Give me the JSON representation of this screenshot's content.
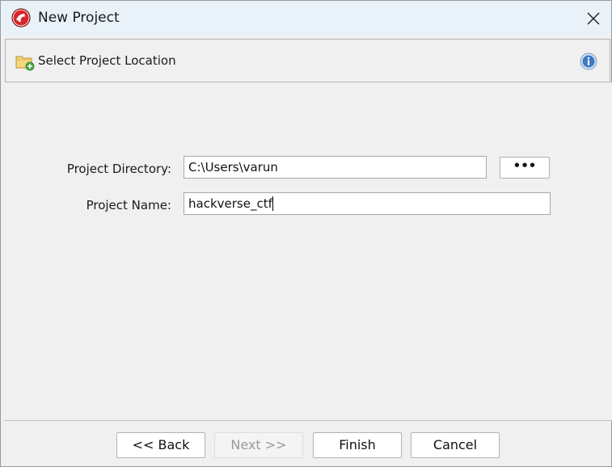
{
  "window": {
    "title": "New Project",
    "title_bar_color": "#e9f2f8"
  },
  "header": {
    "title": "Select Project Location",
    "folder_icon": "folder-add-icon",
    "info_icon": "info-icon"
  },
  "form": {
    "directory_label": "Project Directory:",
    "directory_value": "C:\\Users\\varun",
    "browse_label": "•••",
    "name_label": "Project Name:",
    "name_value": "hackverse_ctf"
  },
  "buttons": {
    "back": "<< Back",
    "next": "Next >>",
    "finish": "Finish",
    "cancel": "Cancel"
  },
  "colors": {
    "app_icon_red": "#d9262b",
    "info_blue": "#3d78c2"
  }
}
